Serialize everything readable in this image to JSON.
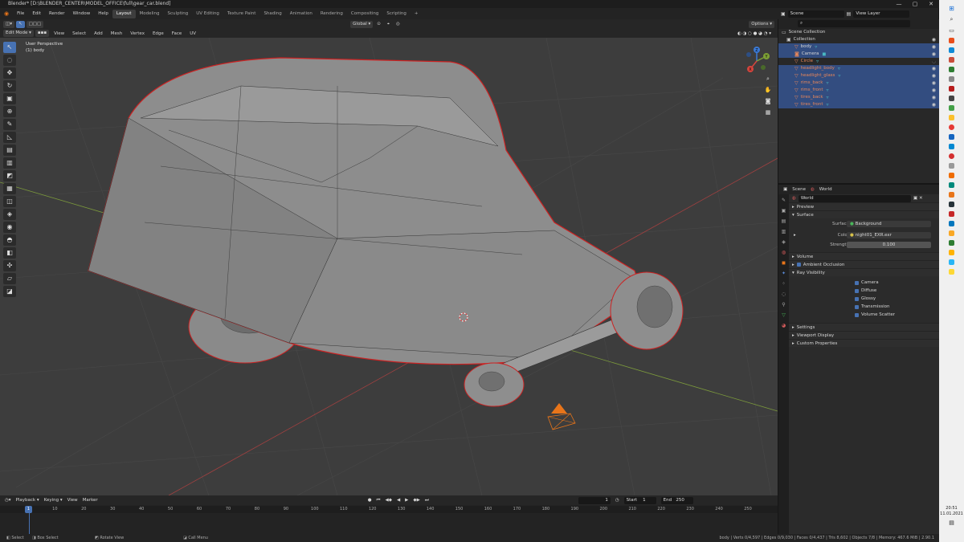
{
  "titlebar": {
    "title": "Blender* [D:\\BLENDER_CENTER\\MODEL_OFFICE\\full\\gear_car.blend]",
    "min": "—",
    "max": "▢",
    "close": "✕"
  },
  "menu": [
    "File",
    "Edit",
    "Render",
    "Window",
    "Help"
  ],
  "workspaces": [
    "Layout",
    "Modeling",
    "Sculpting",
    "UV Editing",
    "Texture Paint",
    "Shading",
    "Animation",
    "Rendering",
    "Compositing",
    "Scripting"
  ],
  "workspace_add": "+",
  "scene": {
    "label": "Scene",
    "view_layer": "View Layer"
  },
  "header3d": {
    "orientation": "Global",
    "options": "Options"
  },
  "header3d2": {
    "mode": "Edit Mode",
    "view": "View",
    "select": "Select",
    "add": "Add",
    "mesh": "Mesh",
    "vertex": "Vertex",
    "edge": "Edge",
    "face": "Face",
    "uv": "UV"
  },
  "viewport": {
    "perspective": "User Perspective",
    "object": "(1) body"
  },
  "gizmo": {
    "z": "Z",
    "y": "Y",
    "x": "X"
  },
  "outliner": {
    "scene_collection": "Scene Collection",
    "collection": "Collection",
    "items": [
      {
        "name": "body",
        "sel": true
      },
      {
        "name": "Camera",
        "sel": true
      },
      {
        "name": "Circle",
        "sel": false
      },
      {
        "name": "headlight_body",
        "sel": true
      },
      {
        "name": "headlight_glass",
        "sel": true
      },
      {
        "name": "rims_back",
        "sel": true
      },
      {
        "name": "rims_front",
        "sel": true
      },
      {
        "name": "tires_back",
        "sel": true
      },
      {
        "name": "tires_front",
        "sel": true
      }
    ]
  },
  "props": {
    "tab_scene": "Scene",
    "tab_world": "World",
    "world_name": "World",
    "preview": "Preview",
    "surface": "Surface",
    "surface_label": "Surface",
    "surface_value": "Background",
    "color_label": "Color",
    "color_value": "night01_EXR.exr",
    "strength_label": "Strength",
    "strength_value": "0.100",
    "volume": "Volume",
    "ambient_occlusion": "Ambient Occlusion",
    "ray_visibility": "Ray Visibility",
    "checks": [
      "Camera",
      "Diffuse",
      "Glossy",
      "Transmission",
      "Volume Scatter"
    ],
    "settings": "Settings",
    "viewport_display": "Viewport Display",
    "custom_properties": "Custom Properties"
  },
  "timeline": {
    "playback": "Playback",
    "keying": "Keying",
    "view": "View",
    "marker": "Marker",
    "current_frame": "1",
    "start_label": "Start",
    "start": "1",
    "end_label": "End",
    "end": "250",
    "ticks": [
      "1",
      "10",
      "20",
      "30",
      "40",
      "50",
      "60",
      "70",
      "80",
      "90",
      "100",
      "110",
      "120",
      "130",
      "140",
      "150",
      "160",
      "170",
      "180",
      "190",
      "200",
      "210",
      "220",
      "230",
      "240",
      "250"
    ]
  },
  "status": {
    "select": "Select",
    "box_select": "Box Select",
    "rotate_view": "Rotate View",
    "call_menu": "Call Menu",
    "stats": "body | Verts 0/4,597 | Edges 0/9,030 | Faces 0/4,437 | Tris 8,602 | Objects 7/8 | Memory: 467.6 MiB | 2.90.1"
  },
  "clock": {
    "time": "20:51",
    "date": "11.01.2021"
  },
  "colors": {
    "accent": "#4772b3",
    "select": "#334d80",
    "edge_seam": "#e83a3a",
    "mesh": "#8c8c8c",
    "camera": "#e8751a"
  }
}
